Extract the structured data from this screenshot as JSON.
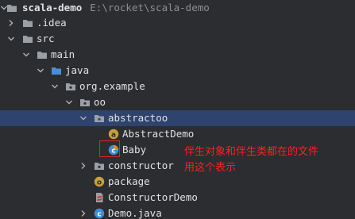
{
  "tree": {
    "root": {
      "name": "scala-demo",
      "path": "E:\\rocket\\scala-demo"
    },
    "idea": {
      "label": ".idea"
    },
    "src": {
      "label": "src"
    },
    "main": {
      "label": "main"
    },
    "java": {
      "label": "java"
    },
    "org_example": {
      "label": "org.example"
    },
    "oo": {
      "label": "oo"
    },
    "abstractoo": {
      "label": "abstractoo"
    },
    "abstract_demo": {
      "label": "AbstractDemo"
    },
    "baby": {
      "label": "Baby"
    },
    "constructor": {
      "label": "constructor"
    },
    "package": {
      "label": "package"
    },
    "constructor_demo": {
      "label": "ConstructorDemo"
    },
    "demo_java": {
      "label": "Demo.java"
    }
  },
  "annotation": {
    "line1": "伴生对象和伴生类都在的文件",
    "line2": "用这个表示"
  },
  "colors": {
    "background": "#2b2d30",
    "selection": "#2e436e",
    "text": "#dfe1e5",
    "path_text": "#8c8f94",
    "annotation": "#e0261f"
  }
}
